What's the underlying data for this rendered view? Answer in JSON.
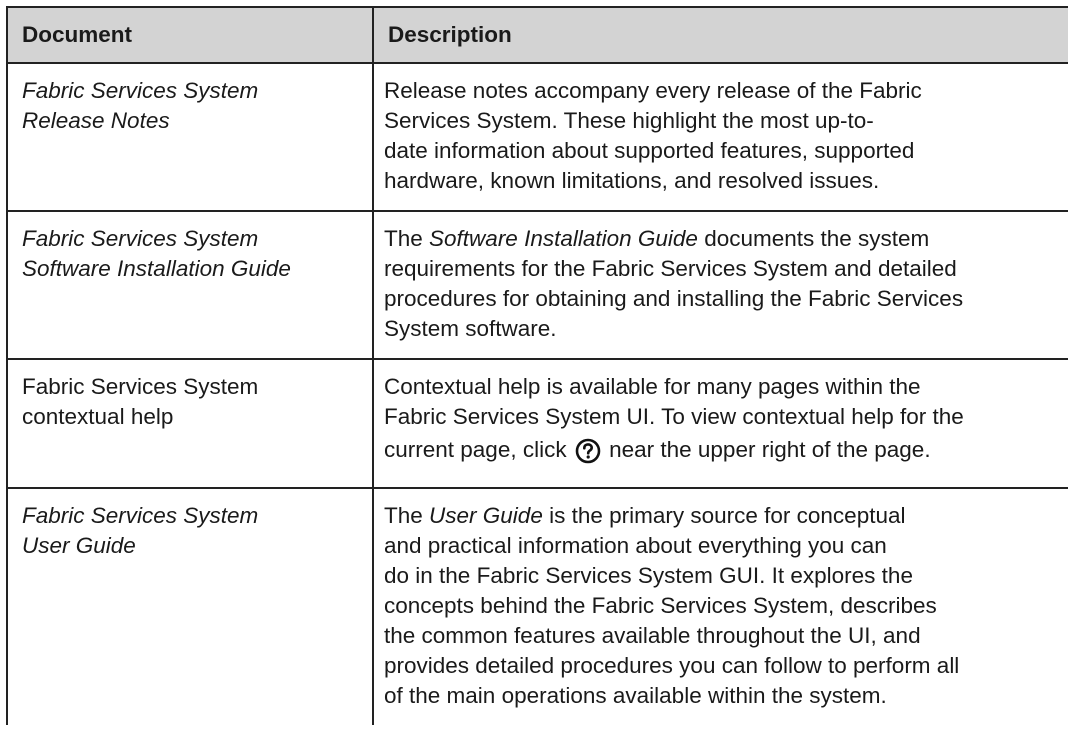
{
  "header": {
    "document": "Document",
    "description": "Description"
  },
  "rows": [
    {
      "doc_lines": [
        "Fabric Services System",
        "Release Notes"
      ],
      "desc_lines": [
        "Release notes accompany every release of the Fabric",
        "Services System. These highlight the most up-to-",
        "date information about supported features, supported",
        "hardware, known limitations, and resolved issues."
      ]
    },
    {
      "doc_lines": [
        "Fabric Services System",
        "Software Installation Guide"
      ],
      "desc_line1": {
        "pre": "The ",
        "em": "Software Installation Guide",
        "post": " documents the system"
      },
      "desc_lines": [
        "requirements for the Fabric Services System and detailed",
        "procedures for obtaining and installing the Fabric Services",
        "System software."
      ]
    },
    {
      "doc_lines": [
        "Fabric Services System",
        "contextual help"
      ],
      "desc_lines": [
        "Contextual help is available for many pages within the",
        "Fabric Services System UI. To view contextual help for the"
      ],
      "desc_line3": {
        "pre": "current page, click ",
        "post": " near the upper right of the page."
      },
      "help_icon": "question-circle-icon"
    },
    {
      "doc_lines": [
        "Fabric Services System",
        "User Guide"
      ],
      "desc_line1": {
        "pre": "The ",
        "em": "User Guide",
        "post": " is the primary source for conceptual"
      },
      "desc_lines": [
        "and practical information about everything you can",
        "do in the Fabric Services System GUI. It explores the",
        "concepts behind the Fabric Services System, describes",
        "the common features available throughout the UI, and",
        "provides detailed procedures you can follow to perform all",
        "of the main operations available within the system."
      ]
    }
  ]
}
